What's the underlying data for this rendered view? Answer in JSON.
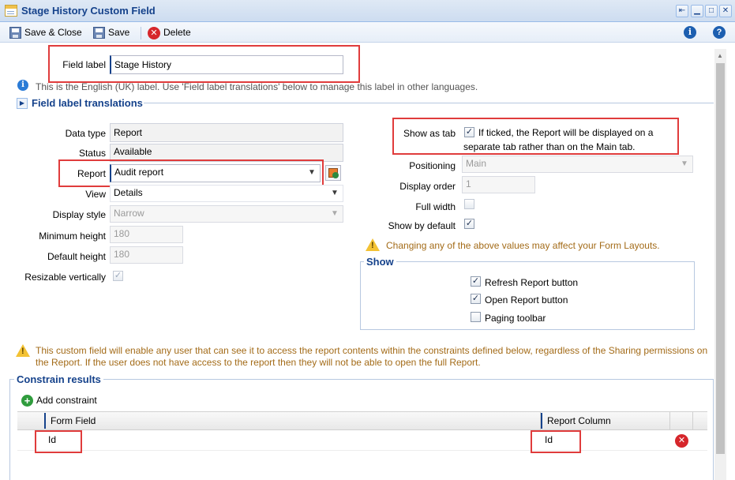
{
  "window": {
    "title": "Stage History Custom Field",
    "controls": [
      "pin-icon",
      "minimize-icon",
      "maximize-icon",
      "close-icon"
    ]
  },
  "toolbar": {
    "save_close_label": "Save & Close",
    "save_label": "Save",
    "delete_label": "Delete"
  },
  "field_label": {
    "label": "Field label",
    "value": "Stage History",
    "info_text": "This is the English (UK) label. Use 'Field label translations' below to manage this label in other languages."
  },
  "translations": {
    "title": "Field label translations"
  },
  "left": {
    "data_type_label": "Data type",
    "data_type_value": "Report",
    "status_label": "Status",
    "status_value": "Available",
    "report_label": "Report",
    "report_value": "Audit report",
    "view_label": "View",
    "view_value": "Details",
    "display_style_label": "Display style",
    "display_style_value": "Narrow",
    "min_height_label": "Minimum height",
    "min_height_value": "180",
    "default_height_label": "Default height",
    "default_height_value": "180",
    "resizable_label": "Resizable vertically"
  },
  "right": {
    "show_as_tab_label": "Show as tab",
    "show_as_tab_text": "If ticked, the Report will be displayed on a separate tab rather than on the Main tab.",
    "positioning_label": "Positioning",
    "positioning_value": "Main",
    "display_order_label": "Display order",
    "display_order_value": "1",
    "full_width_label": "Full width",
    "show_default_label": "Show by default",
    "layout_warning": "Changing any of the above values may affect your Form Layouts.",
    "show_group_title": "Show",
    "refresh_label": "Refresh Report button",
    "open_label": "Open Report button",
    "paging_label": "Paging toolbar"
  },
  "checked": {
    "resizable": true,
    "show_as_tab": true,
    "full_width": false,
    "show_by_default": true,
    "refresh": true,
    "open": true,
    "paging": false
  },
  "access_warning": "This custom field will enable any user that can see it to access the report contents within the constraints defined below, regardless of the Sharing permissions on the Report. If the user does not have access to the report then they will not be able to open the full Report.",
  "constrain": {
    "title": "Constrain results",
    "add_label": "Add constraint",
    "columns": [
      "Form Field",
      "Report Column"
    ],
    "rows": [
      {
        "form_field": "Id",
        "report_column": "Id"
      }
    ]
  },
  "colors": {
    "accent": "#15428b",
    "highlight": "#e03c3c",
    "warning_text": "#a36b18"
  }
}
